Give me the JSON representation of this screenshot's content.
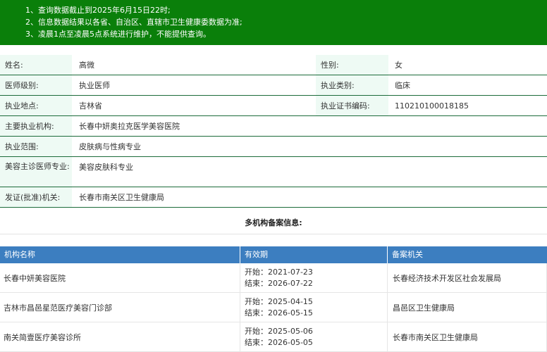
{
  "notice": [
    "1、查询数据截止到2025年6月15日22时;",
    "2、信息数据结果以各省、自治区、直辖市卫生健康委数据为准;",
    "3、凌晨1点至凌晨5点系统进行维护，不能提供查询。"
  ],
  "info": {
    "name_label": "姓名:",
    "name": "高微",
    "gender_label": "性别:",
    "gender": "女",
    "level_label": "医师级别:",
    "level": "执业医师",
    "category_label": "执业类别:",
    "category": "临床",
    "location_label": "执业地点:",
    "location": "吉林省",
    "cert_label": "执业证书编码:",
    "cert": "110210100018185",
    "institution_label": "主要执业机构:",
    "institution": "长春中妍奥拉克医学美容医院",
    "scope_label": "执业范围:",
    "scope": "皮肤病与性病专业",
    "cosmetic_label": "美容主诊医师专业:",
    "cosmetic": "美容皮肤科专业",
    "issuer_label": "发证(批准)机关:",
    "issuer": "长春市南关区卫生健康局"
  },
  "multi": {
    "title": "多机构备案信息:",
    "headers": [
      "机构名称",
      "有效期",
      "备案机关"
    ],
    "rows": [
      {
        "name": "长春中妍美容医院",
        "start": "开始：2021-07-23",
        "end": "结束：2026-07-22",
        "authority": "长春经济技术开发区社会发展局"
      },
      {
        "name": "吉林市昌邑星范医疗美容门诊部",
        "start": "开始：2025-04-15",
        "end": "结束：2026-05-15",
        "authority": "昌邑区卫生健康局"
      },
      {
        "name": "南关简壹医疗美容诊所",
        "start": "开始：2025-05-06",
        "end": "结束：2026-05-05",
        "authority": "长春市南关区卫生健康局"
      }
    ]
  }
}
